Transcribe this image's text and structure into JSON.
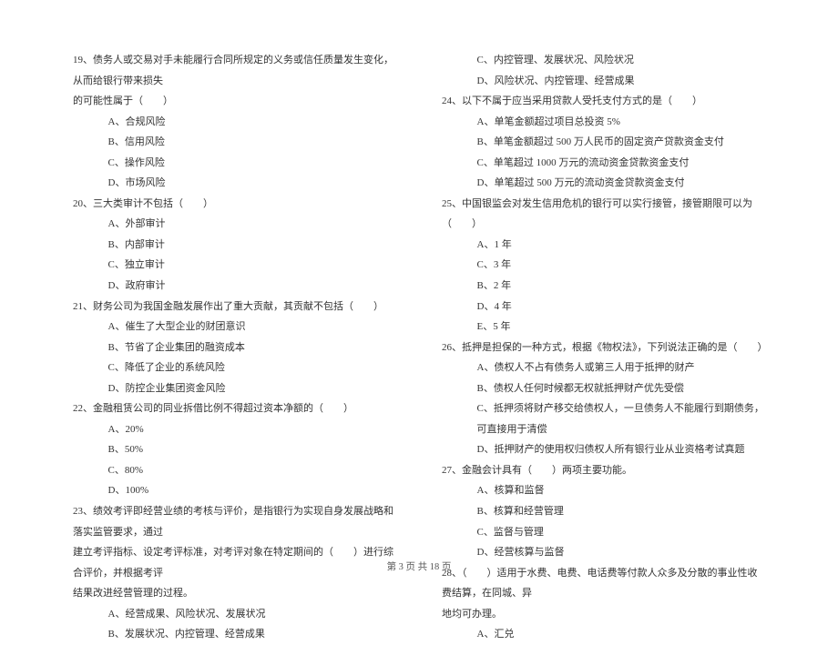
{
  "left": {
    "q19": {
      "stem1": "19、债务人或交易对手未能履行合同所规定的义务或信任质量发生变化，从而给银行带来损失",
      "stem2": "的可能性属于（　　）",
      "a": "A、合规风险",
      "b": "B、信用风险",
      "c": "C、操作风险",
      "d": "D、市场风险"
    },
    "q20": {
      "stem": "20、三大类审计不包括（　　）",
      "a": "A、外部审计",
      "b": "B、内部审计",
      "c": "C、独立审计",
      "d": "D、政府审计"
    },
    "q21": {
      "stem": "21、财务公司为我国金融发展作出了重大贡献，其贡献不包括（　　）",
      "a": "A、催生了大型企业的财团意识",
      "b": "B、节省了企业集团的融资成本",
      "c": "C、降低了企业的系统风险",
      "d": "D、防控企业集团资金风险"
    },
    "q22": {
      "stem": "22、金融租赁公司的同业拆借比例不得超过资本净额的（　　）",
      "a": "A、20%",
      "b": "B、50%",
      "c": "C、80%",
      "d": "D、100%"
    },
    "q23": {
      "stem1": "23、绩效考评即经营业绩的考核与评价，是指银行为实现自身发展战略和落实监管要求，通过",
      "stem2": "建立考评指标、设定考评标准，对考评对象在特定期间的（　　）进行综合评价，并根据考评",
      "stem3": "结果改进经营管理的过程。",
      "a": "A、经营成果、风险状况、发展状况",
      "b": "B、发展状况、内控管理、经营成果"
    }
  },
  "right": {
    "q23c": "C、内控管理、发展状况、风险状况",
    "q23d": "D、风险状况、内控管理、经营成果",
    "q24": {
      "stem": "24、以下不属于应当采用贷款人受托支付方式的是（　　）",
      "a": "A、单笔金额超过项目总投资 5%",
      "b": "B、单笔金额超过 500 万人民币的固定资产贷款资金支付",
      "c": "C、单笔超过 1000 万元的流动资金贷款资金支付",
      "d": "D、单笔超过 500 万元的流动资金贷款资金支付"
    },
    "q25": {
      "stem": "25、中国银监会对发生信用危机的银行可以实行接管，接管期限可以为（　　）",
      "a": "A、1 年",
      "c": "C、3 年",
      "b": "B、2 年",
      "d": "D、4 年",
      "e": "E、5 年"
    },
    "q26": {
      "stem": "26、抵押是担保的一种方式，根据《物权法》，下列说法正确的是（　　）",
      "a": "A、债权人不占有债务人或第三人用于抵押的财产",
      "b": "B、债权人任何时候都无权就抵押财产优先受偿",
      "c": "C、抵押须将财产移交给债权人，一旦债务人不能履行到期债务，可直接用于清偿",
      "d": "D、抵押财产的使用权归债权人所有银行业从业资格考试真题"
    },
    "q27": {
      "stem": "27、金融会计具有（　　）两项主要功能。",
      "a": "A、核算和监督",
      "b": "B、核算和经营管理",
      "c": "C、监督与管理",
      "d": "D、经营核算与监督"
    },
    "q28": {
      "stem1": "28、（　　）适用于水费、电费、电话费等付款人众多及分散的事业性收费结算，在同城、异",
      "stem2": "地均可办理。",
      "a": "A、汇兑"
    }
  },
  "footer": "第 3 页 共 18 页"
}
